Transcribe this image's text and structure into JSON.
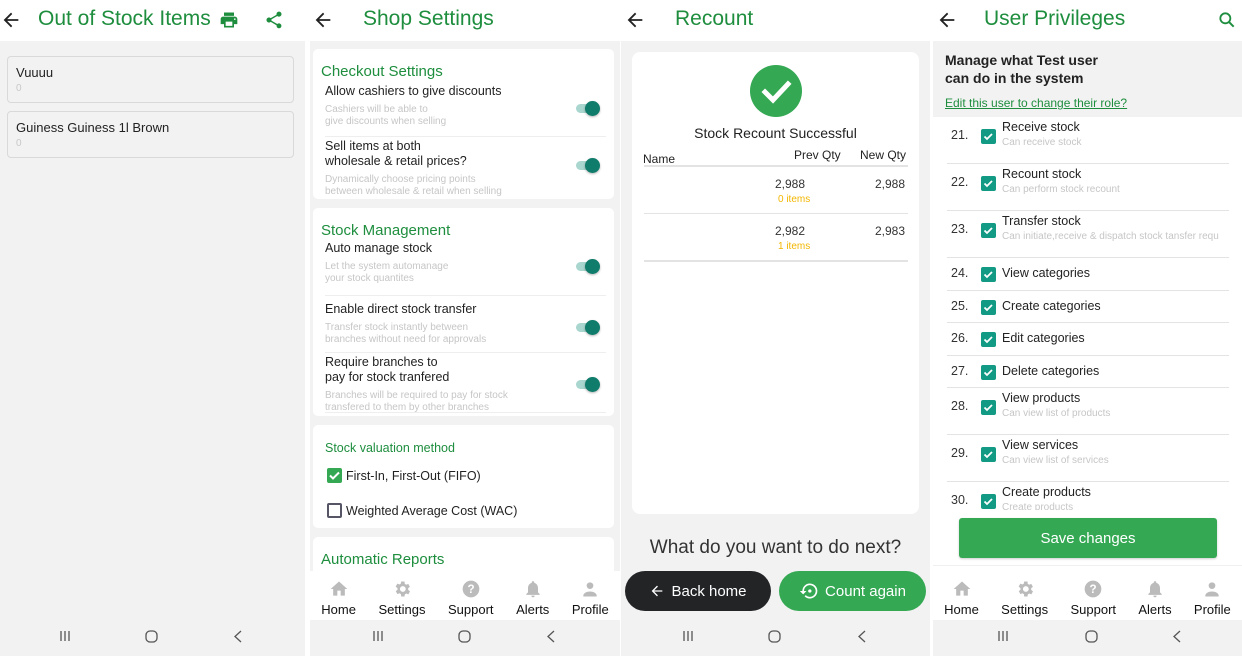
{
  "colors": {
    "brand_green": "#1e8e3e",
    "button_green": "#34a853",
    "toggle_teal": "#0f7c6c",
    "warning_yellow": "#f2b600",
    "dark_button": "#222426"
  },
  "system_nav": {
    "recents_icon": "recents-icon",
    "home_icon": "home-circle-icon",
    "back_icon": "back-chevron-icon"
  },
  "bottom_tabs": [
    {
      "label": "Home",
      "icon": "home-icon"
    },
    {
      "label": "Settings",
      "icon": "gear-icon"
    },
    {
      "label": "Support",
      "icon": "question-icon"
    },
    {
      "label": "Alerts",
      "icon": "bell-icon"
    },
    {
      "label": "Profile",
      "icon": "person-icon"
    }
  ],
  "out_of_stock": {
    "title": "Out of Stock Items",
    "actions": [
      "print-icon",
      "share-icon"
    ],
    "items": [
      {
        "name": "Vuuuu",
        "qty": "0"
      },
      {
        "name": "Guiness Guiness 1l Brown",
        "qty": "0"
      }
    ]
  },
  "shop_settings": {
    "title": "Shop Settings",
    "checkout": {
      "heading": "Checkout Settings",
      "items": [
        {
          "label": "Allow  cashiers to give discounts",
          "sub1": "Cashiers will be able to",
          "sub2": "give discounts when selling",
          "enabled": true
        },
        {
          "label": "Sell items at both",
          "label2": "wholesale & retail prices?",
          "sub1": "Dynamically choose pricing points",
          "sub2": "between wholesale & retail when selling",
          "enabled": true
        }
      ]
    },
    "stock": {
      "heading": "Stock Management",
      "items": [
        {
          "label": "Auto manage stock",
          "sub1": "Let the system automanage",
          "sub2": "your stock quantites",
          "enabled": true
        },
        {
          "label": "Enable direct stock transfer",
          "sub1": "Transfer stock instantly between",
          "sub2": "branches without need for approvals",
          "enabled": true
        },
        {
          "label": "Require branches to",
          "label2": "pay for stock tranfered",
          "sub1": "Branches will be required to pay for stock",
          "sub2": "transfered to them by other branches",
          "enabled": true
        }
      ]
    },
    "valuation": {
      "heading": "Stock valuation method",
      "options": [
        {
          "label": "First-In, First-Out (FIFO)",
          "checked": true
        },
        {
          "label": "Weighted Average Cost (WAC)",
          "checked": false
        }
      ]
    },
    "reports": {
      "heading": "Automatic Reports"
    }
  },
  "recount": {
    "title": "Recount",
    "status": "Stock Recount Successful",
    "columns": [
      "Name",
      "Prev Qty",
      "New Qty"
    ],
    "rows": [
      {
        "name": "",
        "prev": "2,988",
        "diff": "0  items",
        "new": "2,988"
      },
      {
        "name": "",
        "prev": "2,982",
        "diff": "1  items",
        "new": "2,983"
      }
    ],
    "prompt": "What do you want to do next?",
    "back_label": "Back home",
    "again_label": "Count again"
  },
  "privileges": {
    "title": "User Privileges",
    "heading1": "Manage what Test user",
    "heading2": "can do in the system",
    "edit_link": "Edit this user to change their role?",
    "items": [
      {
        "num": "21.",
        "label": "Receive stock",
        "sub": "Can receive stock",
        "checked": true
      },
      {
        "num": "22.",
        "label": "Recount stock",
        "sub": "Can perform stock recount",
        "checked": true
      },
      {
        "num": "23.",
        "label": "Transfer stock",
        "sub": "Can initiate,receive & dispatch  stock tansfer requ",
        "checked": true
      },
      {
        "num": "24.",
        "label": "View categories",
        "sub": "",
        "checked": true
      },
      {
        "num": "25.",
        "label": "Create categories",
        "sub": "",
        "checked": true
      },
      {
        "num": "26.",
        "label": "Edit categories",
        "sub": "",
        "checked": true
      },
      {
        "num": "27.",
        "label": "Delete categories",
        "sub": "",
        "checked": true
      },
      {
        "num": "28.",
        "label": "View products",
        "sub": "Can view list of products",
        "checked": true
      },
      {
        "num": "29.",
        "label": "View services",
        "sub": "Can view list of services",
        "checked": true
      },
      {
        "num": "30.",
        "label": "Create products",
        "sub": "Create products",
        "checked": true
      }
    ],
    "save_label": "Save changes"
  }
}
